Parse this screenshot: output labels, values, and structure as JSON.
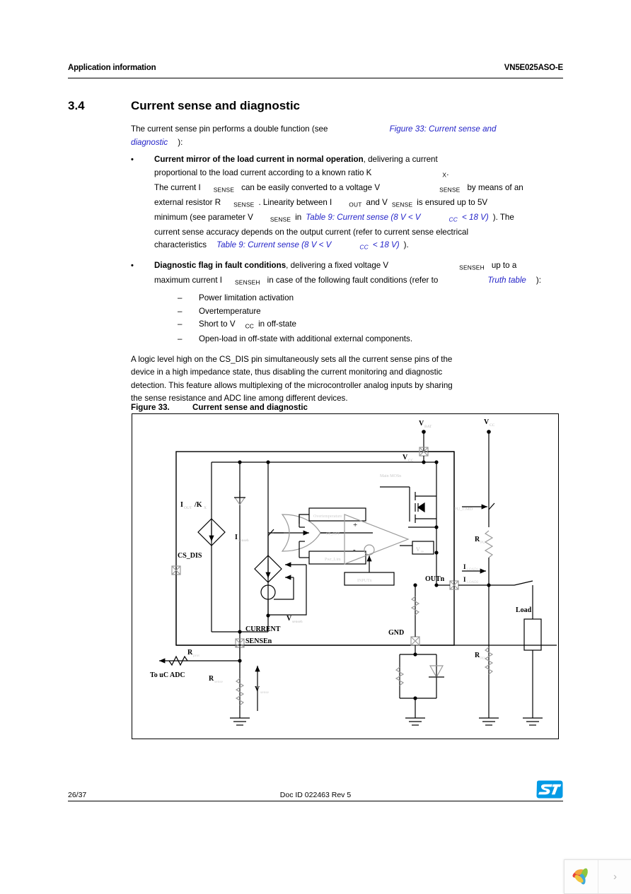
{
  "header": {
    "left": "Application information",
    "right": "VN5E025ASO-E"
  },
  "section": {
    "number": "3.4",
    "title": "Current sense and diagnostic"
  },
  "body": {
    "intro_1": "The current sense pin performs a double function (see",
    "intro_link_1": "Figure 33: Current sense and",
    "intro_link_2": "diagnostic",
    "intro_2": "):",
    "bullet_mark": "•",
    "b1_bold": "Current mirror of the load current in normal operation",
    "b1_t1": ", delivering a current",
    "b1_t2": "proportional to the load current according to a known ratio K",
    "b1_sub_x": "X",
    "b1_t2b": ".",
    "b1_t3": "The current I",
    "b1_sub_sense1": "SENSE",
    "b1_t4": "can be easily converted to a voltage V",
    "b1_sub_sense2": "SENSE",
    "b1_t5": "by means of an",
    "b1_t6": "external resistor R",
    "b1_sub_sense3": "SENSE",
    "b1_t7": ". Linearity between I",
    "b1_sub_out": "OUT",
    "b1_t8": "and V",
    "b1_sub_sense4": "SENSE",
    "b1_t9": "is ensured up to 5V",
    "b1_t10": "minimum (see parameter V",
    "b1_sub_sense5": "SENSE",
    "b1_t11": "in",
    "b1_link_a": "Table 9: Current sense (8 V < V",
    "b1_link_sub_cc": "CC",
    "b1_link_b": "< 18 V)",
    "b1_t12": "). The",
    "b1_t13": "current sense accuracy depends on the output current (refer to current sense electrical",
    "b1_t14": "characteristics",
    "b1_link_c": "Table 9: Current sense (8 V < V",
    "b1_link_sub_cc2": "CC",
    "b1_link_d": "< 18 V)",
    "b1_t15": ").",
    "b2_bold": "Diagnostic flag in fault conditions",
    "b2_t1": ", delivering a fixed voltage V",
    "b2_sub_senseh1": "SENSEH",
    "b2_t2": "up to a",
    "b2_t3": "maximum current I",
    "b2_sub_senseh2": "SENSEH",
    "b2_t4": "in case of the following fault conditions (refer to",
    "b2_link": "Truth table",
    "b2_t5": "):",
    "dash_mark": "–",
    "d1": "Power limitation activation",
    "d2": "Overtemperature",
    "d3a": "Short to V",
    "d3_sub_cc": "CC",
    "d3b": "in off-state",
    "d4": "Open-load in off-state with additional external components.",
    "p2_l1": "A logic level high on the CS_DIS pin simultaneously sets all the current sense pins of the",
    "p2_l2": "device in a high impedance state, thus disabling the current monitoring and diagnostic",
    "p2_l3": "detection. This feature allows multiplexing of the microcontroller analog inputs by sharing",
    "p2_l4": "the sense resistance and ADC line among different devices."
  },
  "figure": {
    "caption_number": "Figure 33.",
    "caption_text": "Current sense and diagnostic",
    "labels": {
      "v_bat": "V",
      "v_bat_sub": "BAT",
      "v_cc_top": "V",
      "v_cc_top_sub": "CC",
      "v_cc_inner": "V",
      "v_cc_inner_sub": "CC",
      "main_mos": "Main MOSn",
      "i_out_k": "I",
      "i_out_k_sub1": "OUT",
      "i_out_k_mid": "/K",
      "i_out_k_sub2": "X",
      "cs_dis": "CS_DIS",
      "i_senseh": "I",
      "i_senseh_sub": "senseh",
      "v_senseh": "V",
      "v_senseh_sub": "senseh",
      "current_sense_1": "CURRENT",
      "current_sense_2": "SENSEn",
      "overtemperature": "Overtemperature",
      "pwr_lim": "Pwr_Lim",
      "st_off": "ST_OFF",
      "inputn": "INPUTn",
      "v_ref": "V",
      "v_ref_sub": "re",
      "outn": "OUTn",
      "gnd": "GND",
      "pu_cmd": "PU_CMD",
      "r_pu": "R",
      "r_pu_sub": "PU",
      "r_pd": "R",
      "r_pd_sub": "PD",
      "i_load1": "I",
      "i_load1_sub": "LOAD1",
      "i_load2": "I",
      "i_load2_sub": "LOAD2",
      "load": "Load",
      "r_prot": "R",
      "r_prot_sub": "prot",
      "r_sense": "R",
      "r_sense_sub": "sense",
      "v_sense": "V",
      "v_sense_sub": "sense",
      "to_uc_adc": "To uC ADC",
      "plus": "+",
      "minus": "-"
    }
  },
  "footer": {
    "page": "26/37",
    "doc": "Doc ID 022463 Rev 5",
    "logo": "st-logo"
  },
  "widget": {
    "logo": "leaf-logo",
    "next": "›"
  },
  "colors": {
    "link": "#2323c8",
    "text": "#000000",
    "st_blue": "#039ae5",
    "faint": "#cfcfcf"
  }
}
